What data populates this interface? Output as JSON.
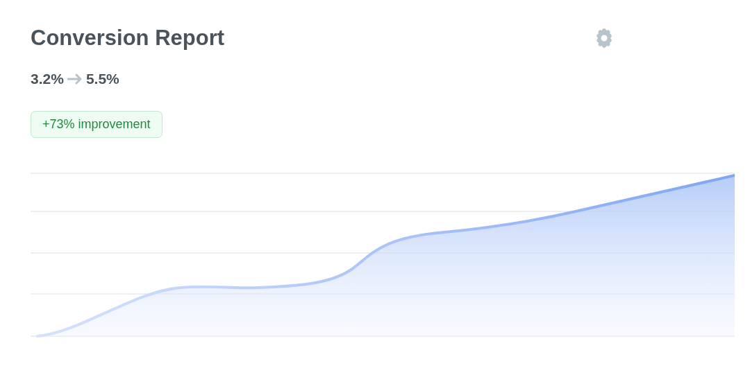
{
  "title": "Conversion Report",
  "rates": {
    "from": "3.2%",
    "to": "5.5%"
  },
  "badge": "+73% improvement"
}
